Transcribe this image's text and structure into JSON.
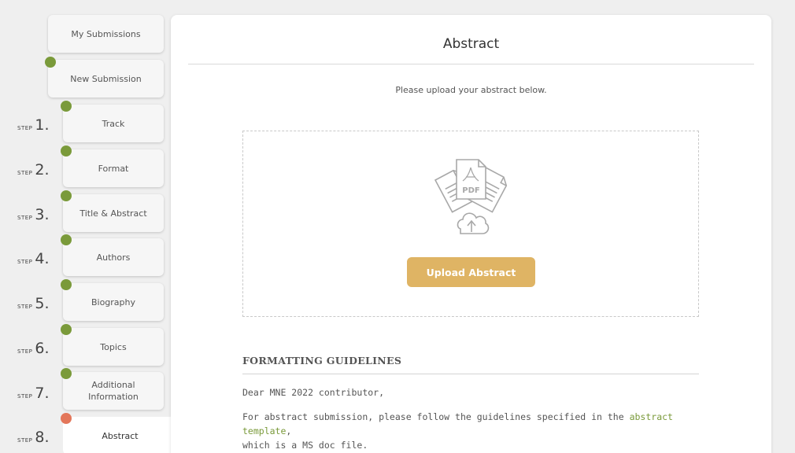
{
  "sidebar": {
    "my_submissions": "My Submissions",
    "new_submission": "New Submission",
    "step_word": "STEP",
    "steps": [
      {
        "num": "1.",
        "label": "Track"
      },
      {
        "num": "2.",
        "label": "Format"
      },
      {
        "num": "3.",
        "label": "Title & Abstract"
      },
      {
        "num": "4.",
        "label": "Authors"
      },
      {
        "num": "5.",
        "label": "Biography"
      },
      {
        "num": "6.",
        "label": "Topics"
      },
      {
        "num": "7.",
        "label": "Additional Information"
      },
      {
        "num": "8.",
        "label": "Abstract"
      }
    ],
    "colors": {
      "complete": "#7a9a3a",
      "current": "#e3765a"
    }
  },
  "main": {
    "title": "Abstract",
    "intro": "Please upload your abstract below.",
    "upload": {
      "pdf_label": "PDF",
      "button_label": "Upload Abstract",
      "button_color": "#dfb464"
    },
    "guidelines": {
      "heading": "FORMATTING GUIDELINES",
      "greeting": "Dear MNE 2022 contributor,",
      "para_before_link": "For abstract submission, please follow the guidelines specified in the ",
      "link_text": "abstract template",
      "para_after_link": ",",
      "para_line2": "which is a MS doc file.",
      "link_color": "#7a9a3a"
    }
  }
}
